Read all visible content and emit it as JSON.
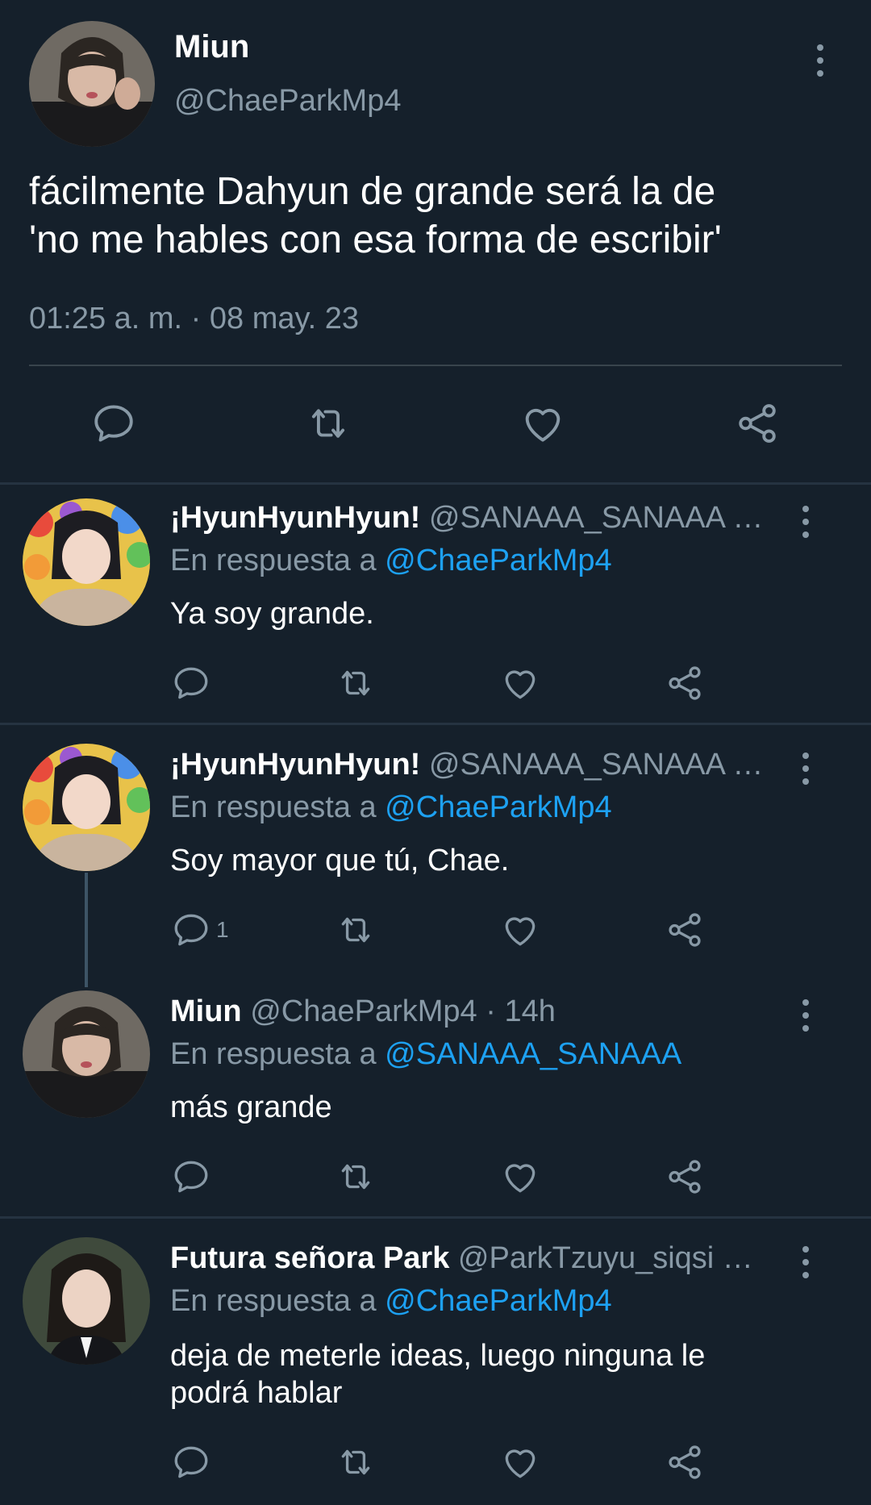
{
  "main_tweet": {
    "name": "Miun",
    "handle": "@ChaeParkMp4",
    "text_line1": "fácilmente Dahyun de grande será la de",
    "text_line2": "'no me hables con esa forma de escribir'",
    "timestamp": "01:25 a. m. · 08 may. 23"
  },
  "replies": [
    {
      "name": "¡HyunHyunHyun!",
      "handle": "@SANAAA_SANAAA …",
      "reply_prefix": "En respuesta a",
      "reply_to": "@ChaeParkMp4",
      "text": "Ya soy grande.",
      "reply_count": ""
    },
    {
      "name": "¡HyunHyunHyun!",
      "handle": "@SANAAA_SANAAA …",
      "reply_prefix": "En respuesta a",
      "reply_to": "@ChaeParkMp4",
      "text": "Soy mayor que tú, Chae.",
      "reply_count": "1"
    },
    {
      "name": "Miun",
      "handle": "@ChaeParkMp4 · 14h",
      "reply_prefix": "En respuesta a",
      "reply_to": "@SANAAA_SANAAA",
      "text": "más grande",
      "reply_count": ""
    },
    {
      "name": "Futura señora Park",
      "handle": "@ParkTzuyu_siqsi …",
      "reply_prefix": "En respuesta a",
      "reply_to": "@ChaeParkMp4",
      "text_line1": "deja de meterle ideas, luego ninguna le",
      "text_line2": "podrá hablar",
      "reply_count": ""
    }
  ],
  "icons": {
    "reply": "speech-bubble-icon",
    "retweet": "retweet-icon",
    "like": "heart-icon",
    "share": "share-icon",
    "more": "vertical-dots-icon"
  },
  "colors": {
    "background": "#15202b",
    "text": "#ffffff",
    "muted": "#8899a6",
    "link": "#1da1f2",
    "divider": "#253341"
  }
}
